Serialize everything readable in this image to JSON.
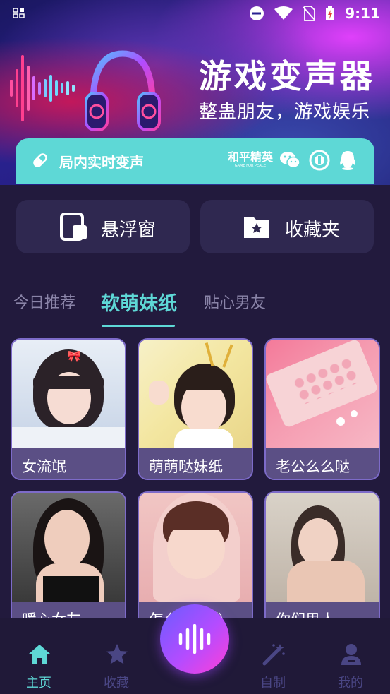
{
  "status_bar": {
    "time": "9:11"
  },
  "banner": {
    "title": "游戏变声器",
    "subtitle": "整蛊朋友，游戏娱乐",
    "realtime_label": "局内实时变声",
    "game_logo_text": "和平精英",
    "game_logo_sub": "GAME FOR PEACE"
  },
  "quick_actions": {
    "floating_window": "悬浮窗",
    "favorites": "收藏夹"
  },
  "tabs": [
    "今日推荐",
    "软萌妹纸",
    "贴心男友"
  ],
  "active_tab": 1,
  "cards": [
    {
      "label": "女流氓"
    },
    {
      "label": "萌萌哒妹纸"
    },
    {
      "label": "老公么么哒"
    },
    {
      "label": "暖心女友"
    },
    {
      "label": "怎么不理我"
    },
    {
      "label": "你们男人"
    }
  ],
  "bottom_nav": {
    "home": "主页",
    "favorites": "收藏",
    "custom": "自制",
    "mine": "我的"
  },
  "colors": {
    "accent": "#5ed8d6",
    "background": "#221a3d",
    "card_caption": "#5b4f85",
    "nav_inactive": "#4a4684"
  }
}
